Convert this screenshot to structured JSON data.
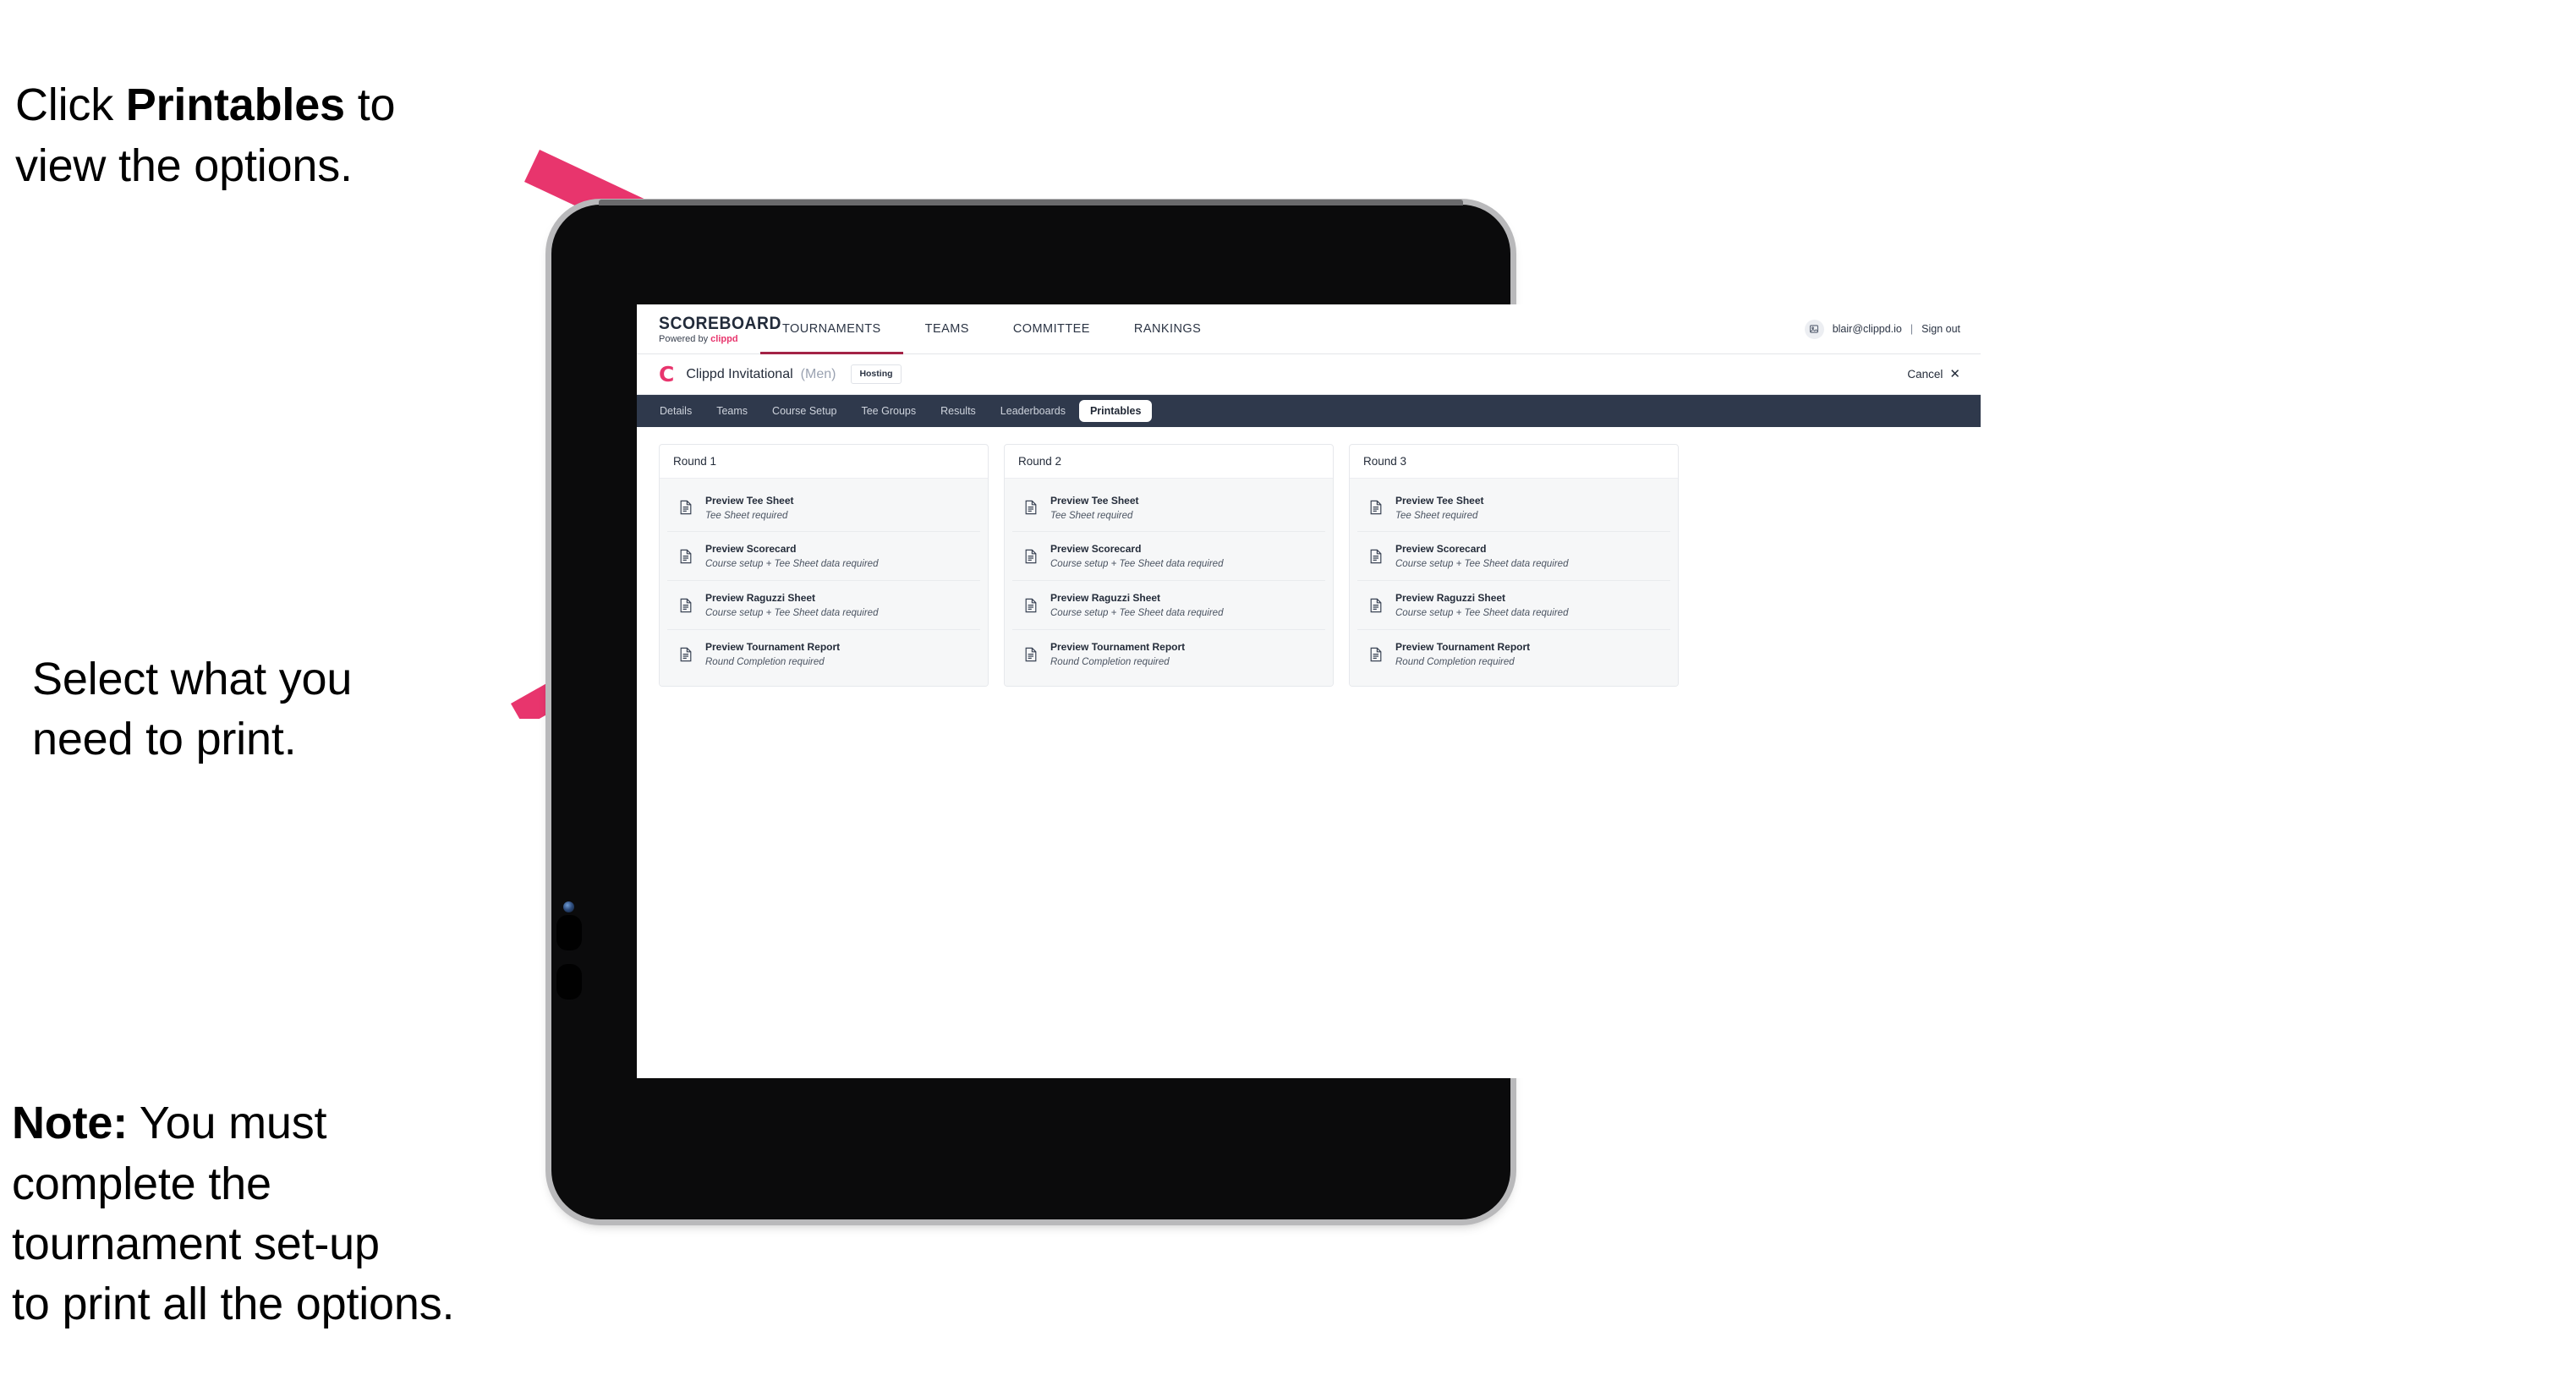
{
  "annotations": [
    {
      "id": "annot-1",
      "text_before": "Click ",
      "bold": "Printables",
      "text_after": " to\nview the options."
    },
    {
      "id": "annot-2",
      "text": "Select what you\n need to print."
    },
    {
      "id": "annot-3",
      "text_before": "",
      "bold": "Note:",
      "text_after": " You must\ncomplete the\ntournament set-up\nto print all the options."
    }
  ],
  "browser": {
    "topbar": {
      "brand": {
        "title": "SCOREBOARD",
        "powered_prefix": "Powered by ",
        "powered_brand": "clippd"
      },
      "nav": [
        {
          "label": "TOURNAMENTS",
          "active": true
        },
        {
          "label": "TEAMS",
          "active": false
        },
        {
          "label": "COMMITTEE",
          "active": false
        },
        {
          "label": "RANKINGS",
          "active": false
        }
      ],
      "user_email": "blair@clippd.io",
      "separator": "|",
      "sign_out": "Sign out",
      "avatar_icon": "user-avatar-icon"
    },
    "tournament_bar": {
      "logo_mark": "C",
      "name": "Clippd Invitational",
      "gender": "(Men)",
      "badge": "Hosting",
      "cancel_label": "Cancel",
      "cancel_icon": "✕"
    },
    "subnav": [
      {
        "label": "Details",
        "active": false
      },
      {
        "label": "Teams",
        "active": false
      },
      {
        "label": "Course Setup",
        "active": false
      },
      {
        "label": "Tee Groups",
        "active": false
      },
      {
        "label": "Results",
        "active": false
      },
      {
        "label": "Leaderboards",
        "active": false
      },
      {
        "label": "Printables",
        "active": true
      }
    ],
    "rounds": [
      {
        "title": "Round 1",
        "items": [
          {
            "title": "Preview Tee Sheet",
            "subtitle": "Tee Sheet required"
          },
          {
            "title": "Preview Scorecard",
            "subtitle": "Course setup + Tee Sheet data required"
          },
          {
            "title": "Preview Raguzzi Sheet",
            "subtitle": "Course setup + Tee Sheet data required"
          },
          {
            "title": "Preview Tournament Report",
            "subtitle": "Round Completion required"
          }
        ]
      },
      {
        "title": "Round 2",
        "items": [
          {
            "title": "Preview Tee Sheet",
            "subtitle": "Tee Sheet required"
          },
          {
            "title": "Preview Scorecard",
            "subtitle": "Course setup + Tee Sheet data required"
          },
          {
            "title": "Preview Raguzzi Sheet",
            "subtitle": "Course setup + Tee Sheet data required"
          },
          {
            "title": "Preview Tournament Report",
            "subtitle": "Round Completion required"
          }
        ]
      },
      {
        "title": "Round 3",
        "items": [
          {
            "title": "Preview Tee Sheet",
            "subtitle": "Tee Sheet required"
          },
          {
            "title": "Preview Scorecard",
            "subtitle": "Course setup + Tee Sheet data required"
          },
          {
            "title": "Preview Raguzzi Sheet",
            "subtitle": "Course setup + Tee Sheet data required"
          },
          {
            "title": "Preview Tournament Report",
            "subtitle": "Round Completion required"
          }
        ]
      }
    ]
  },
  "colors": {
    "accent_pink": "#e8356d",
    "nav_dark": "#2f394c",
    "active_underline": "#a32346",
    "card_bg": "#f6f7f8",
    "tablet_body": "#0b0b0c",
    "tablet_bezel": "#b9b9bb"
  }
}
